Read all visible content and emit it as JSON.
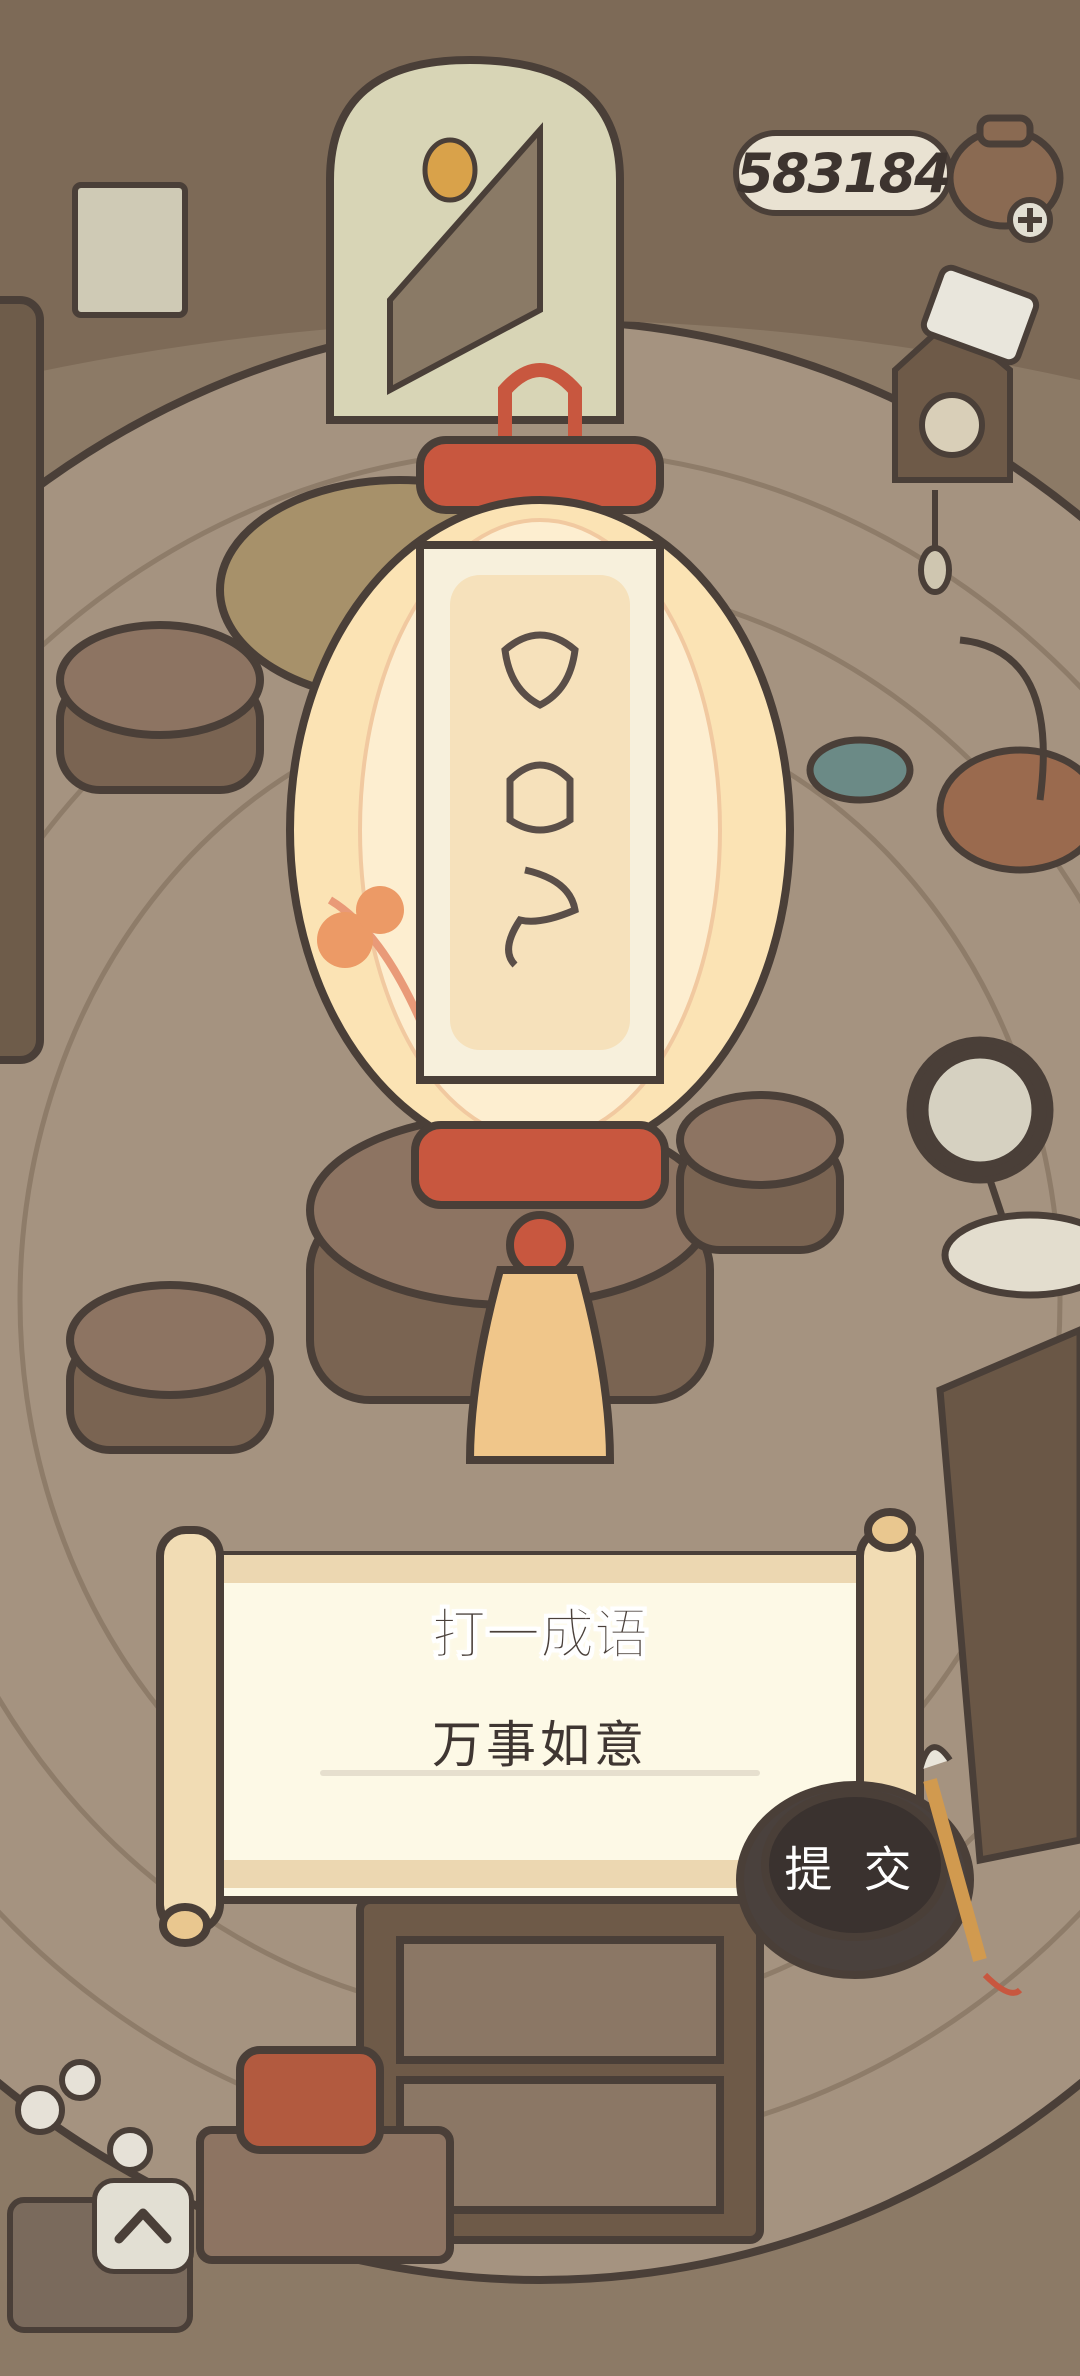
{
  "currency": {
    "amount": "583184",
    "icon": "teapot-icon",
    "add_icon": "plus-icon"
  },
  "riddle": {
    "title": "打一成语",
    "answer": "万事如意",
    "submit_label": "提 交"
  },
  "nav": {
    "expand_icon": "chevron-up-icon"
  },
  "colors": {
    "background": "#8c7a66",
    "scroll_paper": "#fdf9e6",
    "outline": "#4a3f38",
    "lantern_red": "#c8573f",
    "lantern_glow": "#fbe3b4"
  }
}
